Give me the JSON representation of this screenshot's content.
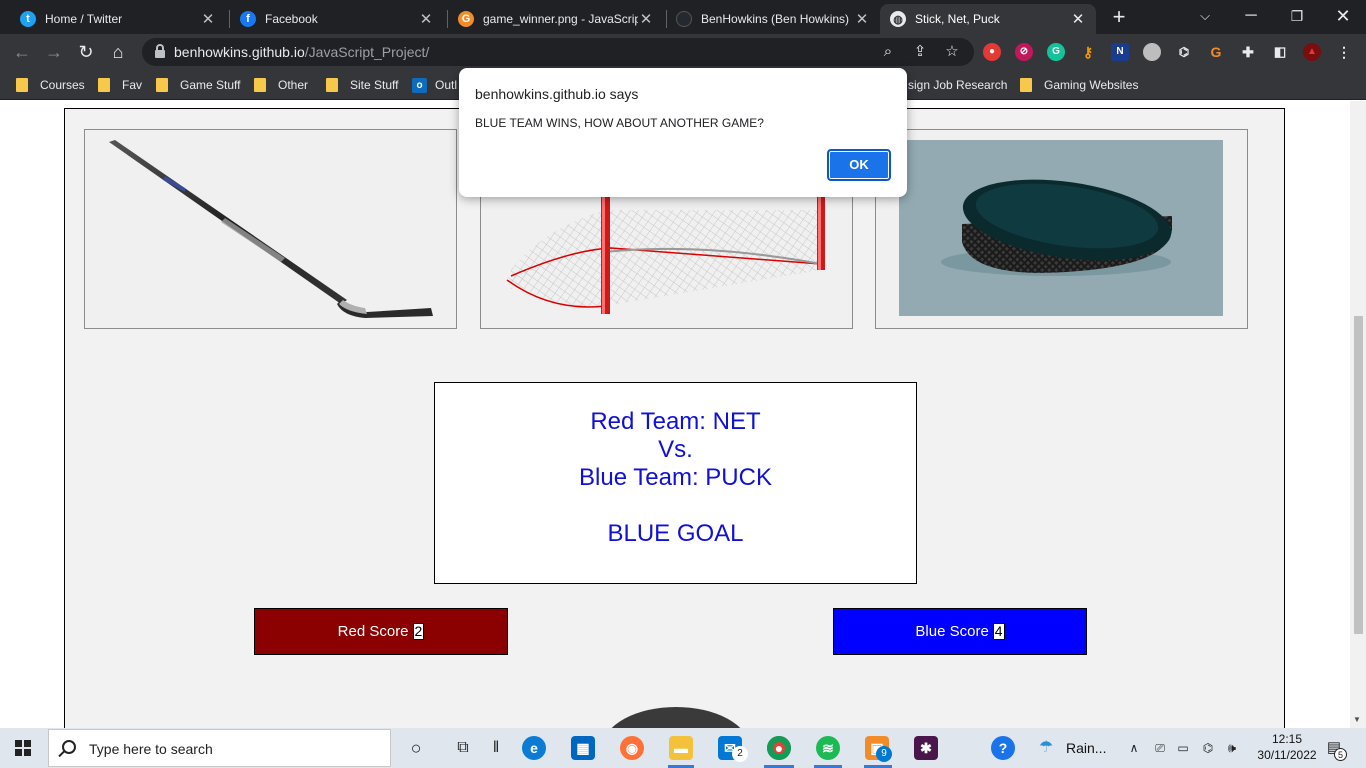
{
  "browser": {
    "tabs": [
      {
        "title": "Home / Twitter",
        "icon": "twitter-icon",
        "color": "#1da1f2",
        "glyph": "t"
      },
      {
        "title": "Facebook",
        "icon": "facebook-icon",
        "color": "#1877f2",
        "glyph": "f"
      },
      {
        "title": "game_winner.png - JavaScrip",
        "icon": "gitpod-icon",
        "color": "#f28c28",
        "glyph": "G"
      },
      {
        "title": "BenHowkins (Ben Howkins)",
        "icon": "github-icon",
        "color": "#24292f",
        "glyph": ""
      },
      {
        "title": "Stick, Net, Puck",
        "icon": "globe-icon",
        "color": "#9aa0a6",
        "glyph": ""
      }
    ],
    "url_domain": "benhowkins.github.io",
    "url_path": "/JavaScript_Project/",
    "bookmarks": [
      "Courses",
      "Fav",
      "Game Stuff",
      "Other",
      "Site Stuff",
      "Outl",
      "sign Job Research",
      "Gaming Websites"
    ]
  },
  "dialog": {
    "title": "benhowkins.github.io says",
    "message": "BLUE TEAM WINS, HOW ABOUT ANOTHER GAME?",
    "ok_label": "OK"
  },
  "game": {
    "images": [
      "stick",
      "net",
      "puck"
    ],
    "result": {
      "red_line": "Red Team: NET",
      "vs_line": "Vs.",
      "blue_line": "Blue Team: PUCK",
      "outcome": "BLUE GOAL"
    },
    "red_score_label": "Red Score",
    "red_score": "2",
    "blue_score_label": "Blue Score",
    "blue_score": "4",
    "colors": {
      "red": "#8b0000",
      "blue": "#0000ff",
      "result_text": "#1010d8"
    }
  },
  "taskbar": {
    "search_placeholder": "Type here to search",
    "weather": "Rain...",
    "time": "12:15",
    "date": "30/11/2022",
    "mail_badge": "2",
    "app_badge": "9",
    "notification_count": "5"
  }
}
